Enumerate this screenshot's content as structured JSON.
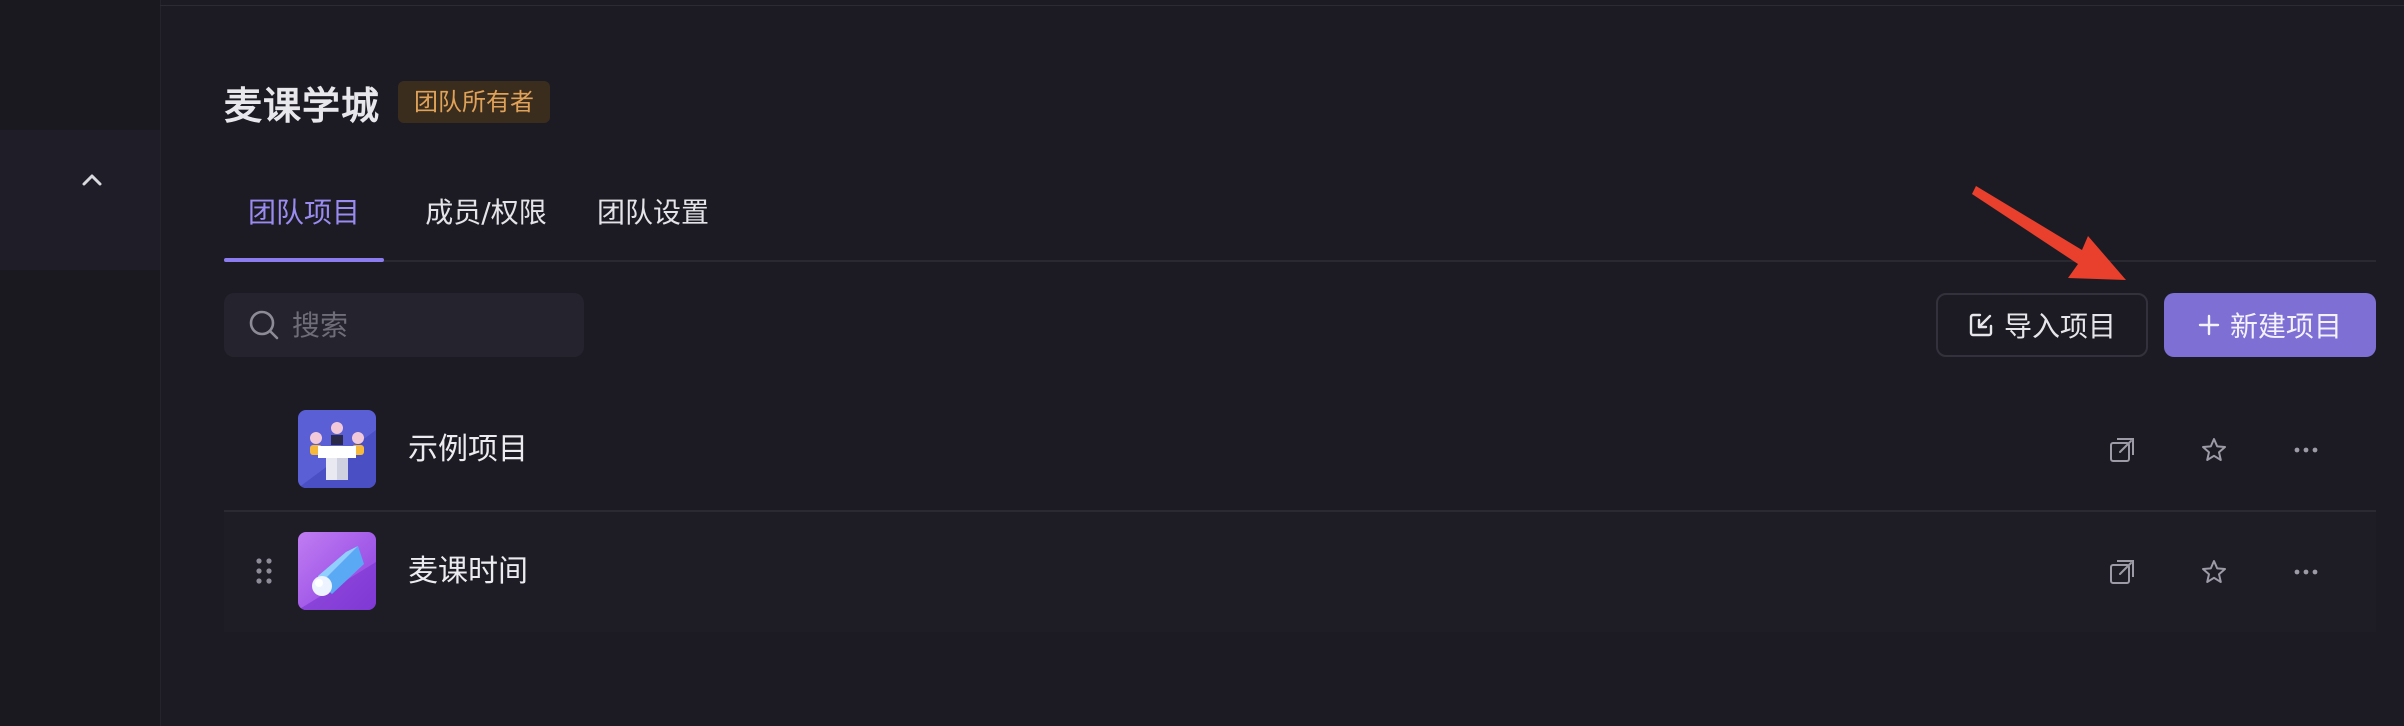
{
  "team": {
    "name": "麦课学城",
    "role_badge": "团队所有者"
  },
  "tabs": [
    {
      "label": "团队项目",
      "active": true
    },
    {
      "label": "成员/权限",
      "active": false
    },
    {
      "label": "团队设置",
      "active": false
    }
  ],
  "search": {
    "placeholder": "搜索"
  },
  "toolbar": {
    "import_label": "导入项目",
    "new_label": "新建项目"
  },
  "projects": [
    {
      "name": "示例项目",
      "icon": "team-meeting-icon"
    },
    {
      "name": "麦课时间",
      "icon": "comet-icon"
    }
  ],
  "colors": {
    "accent": "#8b7cf0",
    "primary_button": "#7d6fd3",
    "badge_text": "#e0a259",
    "badge_bg": "#3b2d1d",
    "annotation_arrow": "#e8402c"
  }
}
